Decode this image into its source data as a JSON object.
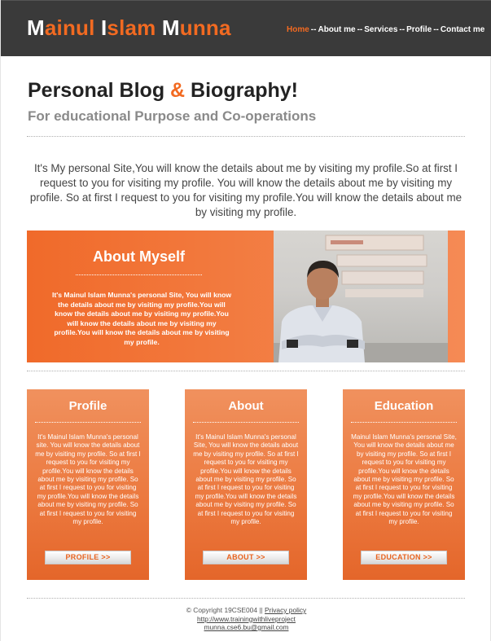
{
  "header": {
    "logo": {
      "words": [
        {
          "cap": "M",
          "rest": "ainul "
        },
        {
          "cap": "I",
          "rest": "slam "
        },
        {
          "cap": "M",
          "rest": "unna"
        }
      ]
    },
    "nav": [
      {
        "label": "Home",
        "active": true
      },
      {
        "label": "About me",
        "active": false
      },
      {
        "label": "Services",
        "active": false
      },
      {
        "label": "Profile",
        "active": false
      },
      {
        "label": "Contact me",
        "active": false
      }
    ],
    "nav_separator": "--"
  },
  "hero": {
    "title_part1": "Personal Blog ",
    "title_amp": "&",
    "title_part2": " Biography!",
    "subtitle": "For educational Purpose and Co-operations"
  },
  "intro": "It's My personal Site,You will know the details about me by visiting my profile.So at first I request to you for visiting my profile. You will know the details about me by visiting my profile. So at first I request to you for visiting my profile.You will know the details about me by visiting my profile.",
  "about": {
    "title": "About Myself",
    "text": "It's Mainul Islam Munna's personal Site, You will know the details about me by visiting my profile.You will know the details about me by visiting my profile.You will know the details about me by visiting my profile.You will know the details about me by visiting my profile."
  },
  "cards": [
    {
      "title": "Profile",
      "text": "It's Mainul Islam Munna's personal site. You will know the details about me by visiting my profile. So at first I request to you for visiting my profile.You will know the details about me by visiting my profile. So at first I request to you for visiting my profile.You will know the details about me by visiting my profile. So at first I request to you for visiting my profile.",
      "button": "PROFILE >>"
    },
    {
      "title": "About",
      "text": "It's Mainul Islam Munna's personal Site, You will know the details about me by visiting my profile. So at first I request to you for visiting my profile.You will know the details about me by visiting my profile. So at first I request to you for visiting my profile.You will know the details about me by visiting my profile. So at first I request to you for visiting my profile.",
      "button": "ABOUT >>"
    },
    {
      "title": "Education",
      "text": "Mainul Islam Munna's personal Site, You will know the details about me by visiting my profile. So at first I request to you for visiting my profile.You will know the details about me by visiting my profile. So at first I request to you for visiting my profile.You will know the details about me by visiting my profile. So at first I request to you for visiting my profile.",
      "button": "EDUCATION >>"
    }
  ],
  "footer": {
    "copyright": "© Copyright 19CSE004",
    "separator": " || ",
    "privacy": "Privacy policy",
    "link": "http://www.trainingwithliveproject",
    "email": "munna.cse6.bu@gmail.com"
  },
  "colors": {
    "accent": "#f26a21",
    "header_bg": "#3a3a3a"
  }
}
